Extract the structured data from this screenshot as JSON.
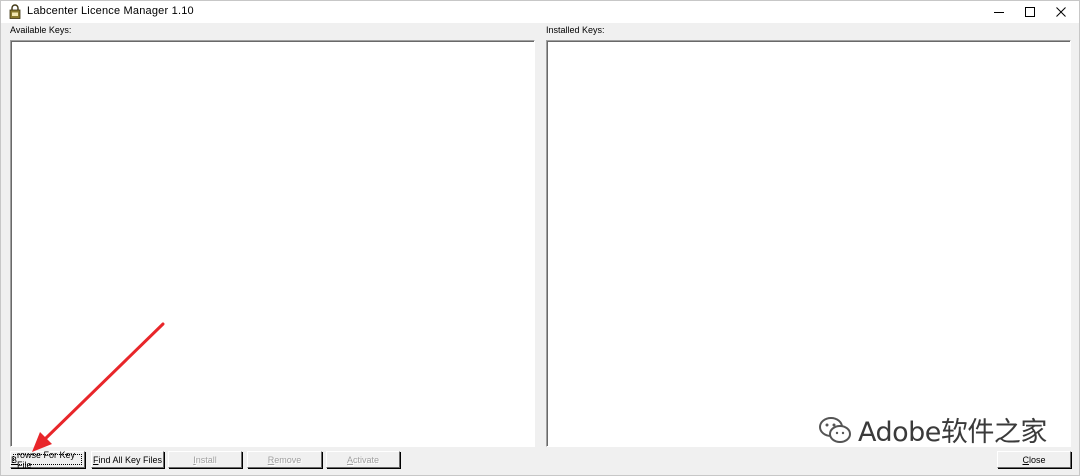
{
  "window": {
    "title": "Labcenter Licence Manager 1.10"
  },
  "panels": {
    "available_label": "Available Keys:",
    "installed_label": "Installed Keys:"
  },
  "buttons": {
    "browse": {
      "underline": "B",
      "rest": "rowse For Key File"
    },
    "find": {
      "underline": "F",
      "rest": "ind All Key Files"
    },
    "install": {
      "underline": "I",
      "rest": "nstall"
    },
    "remove": {
      "underline": "R",
      "rest": "emove"
    },
    "activate": {
      "underline": "A",
      "rest": "ctivate"
    },
    "close": {
      "underline": "C",
      "rest": "lose"
    }
  },
  "watermark": {
    "text": "Adobe软件之家"
  },
  "colors": {
    "window_bg": "#f0f0f0",
    "arrow": "#e8262a"
  }
}
